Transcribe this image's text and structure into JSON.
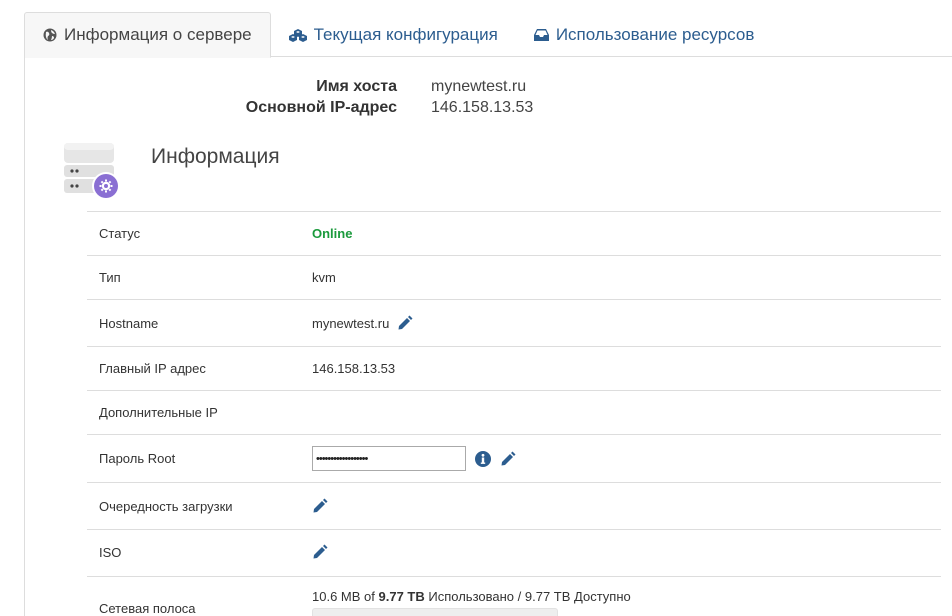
{
  "tabs": [
    {
      "label": "Информация о сервере",
      "icon": "globe-icon"
    },
    {
      "label": "Текущая конфигурация",
      "icon": "cubes-icon"
    },
    {
      "label": "Использование ресурсов",
      "icon": "inbox-icon"
    }
  ],
  "summary": {
    "hostname_label": "Имя хоста",
    "hostname_value": "mynewtest.ru",
    "ip_label": "Основной IP-адрес",
    "ip_value": "146.158.13.53"
  },
  "info": {
    "title": "Информация"
  },
  "rows": {
    "status": {
      "label": "Статус",
      "value": "Online"
    },
    "type": {
      "label": "Тип",
      "value": "kvm"
    },
    "hostname": {
      "label": "Hostname",
      "value": "mynewtest.ru"
    },
    "main_ip": {
      "label": "Главный IP адрес",
      "value": "146.158.13.53"
    },
    "extra_ip": {
      "label": "Дополнительные IP",
      "value": ""
    },
    "root_password": {
      "label": "Пароль Root",
      "value": "••••••••••••••••••"
    },
    "boot_order": {
      "label": "Очередность загрузки"
    },
    "iso": {
      "label": "ISO"
    },
    "bandwidth": {
      "label": "Сетевая полоса",
      "used": "10.6 MB",
      "of": "of",
      "total": "9.77 TB",
      "used_word": "Использовано /",
      "available": "9.77 TB Доступно",
      "usage_percent": 0
    }
  },
  "colors": {
    "link": "#2c5d8f",
    "online": "#1a9a3c",
    "icon_accent": "#7b5fc7"
  }
}
